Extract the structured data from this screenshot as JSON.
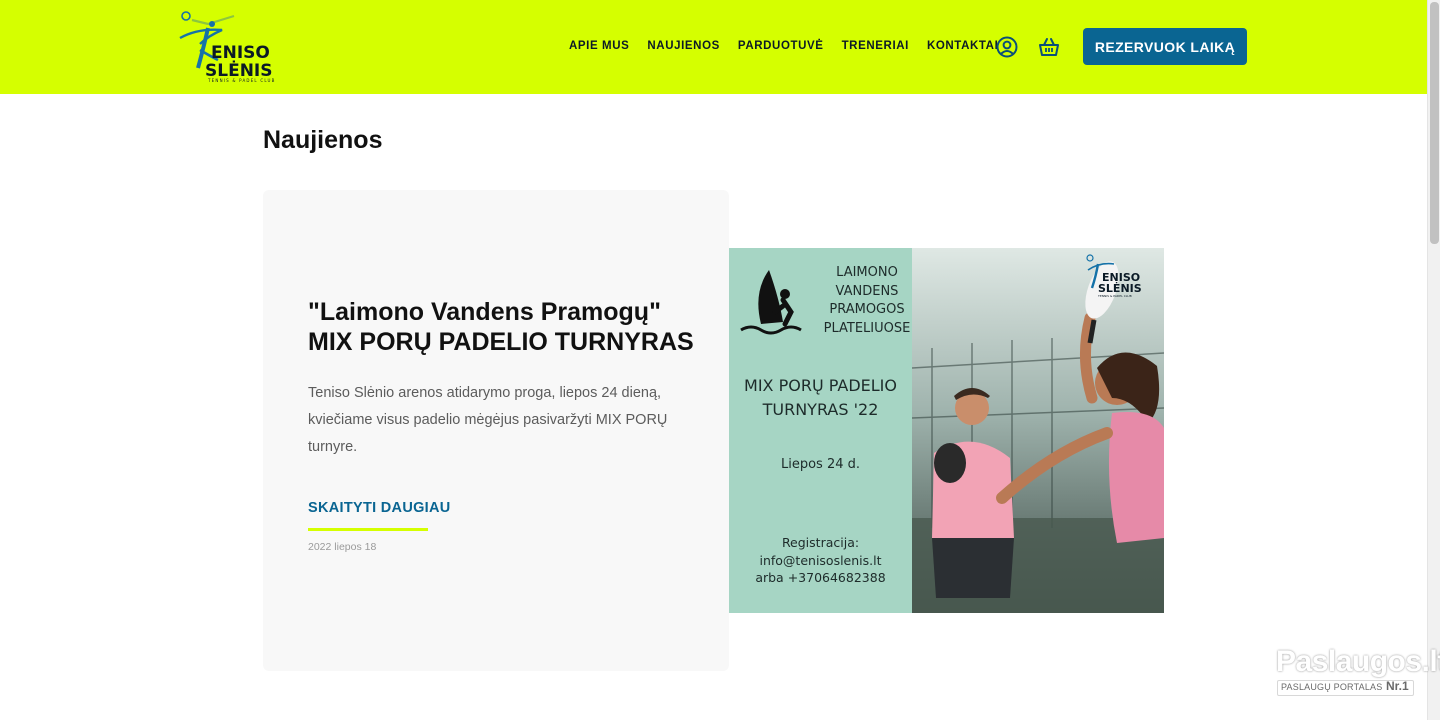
{
  "header": {
    "logo_text_line1": "ENISO",
    "logo_text_line2": "SLĖNIS",
    "logo_tagline": "TENNIS & PADEL CLUB",
    "nav": [
      {
        "label": "APIE MUS"
      },
      {
        "label": "NAUJIENOS"
      },
      {
        "label": "PARDUOTUVĖ"
      },
      {
        "label": "TRENERIAI"
      },
      {
        "label": "KONTAKTAI"
      }
    ],
    "account_icon": "user-circle-icon",
    "cart_icon": "basket-icon",
    "cta_label": "REZERVUOK LAIKĄ"
  },
  "page_title": "Naujienos",
  "post": {
    "title": "\"Laimono Vandens Pramogų\" MIX PORŲ PADELIO TURNYRAS",
    "excerpt": "Teniso Slėnio arenos atidarymo proga, liepos 24 dieną, kviečiame visus padelio mėgėjus pasivaržyti MIX PORŲ turnyre.",
    "read_more": "SKAITYTI DAUGIAU",
    "date": "2022 liepos 18"
  },
  "poster": {
    "org_lines": [
      "LAIMONO",
      "VANDENS",
      "PRAMOGOS",
      "PLATELIUOSE"
    ],
    "event_lines": [
      "MIX PORŲ PADELIO",
      "TURNYRAS '22"
    ],
    "date": "Liepos 24 d.",
    "registration_lines": [
      "Registracija:",
      "info@tenisoslenis.lt",
      "arba +37064682388"
    ],
    "logo_line1": "ENISO",
    "logo_line2": "SLĖNIS",
    "logo_tagline": "TENNIS & PADEL CLUB"
  },
  "watermark": {
    "name": "Paslaugos.lt",
    "subtitle": "PASLAUGŲ PORTALAS",
    "badge": "Nr.1"
  },
  "colors": {
    "header_bg": "#d5ff00",
    "brand_blue": "#0a6592",
    "logo_blue": "#1572a8",
    "logo_green": "#8cc63f",
    "poster_mint": "#a6d5c4"
  }
}
